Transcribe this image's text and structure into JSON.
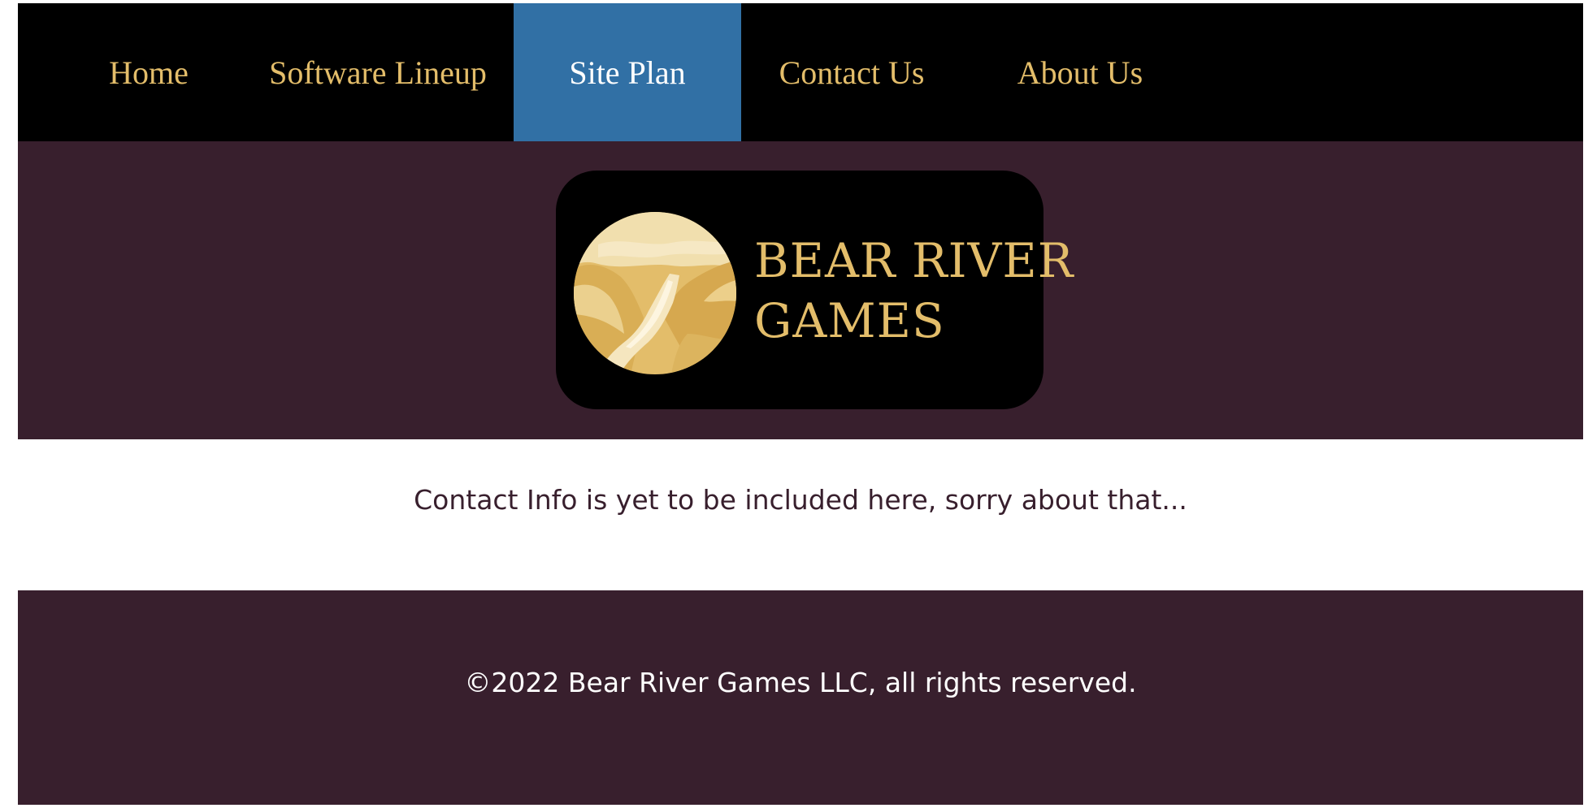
{
  "nav": {
    "items": [
      {
        "label": "Home",
        "active": false
      },
      {
        "label": "Software Lineup",
        "active": false
      },
      {
        "label": "Site Plan",
        "active": true
      },
      {
        "label": "Contact Us",
        "active": false
      },
      {
        "label": "About Us",
        "active": false
      }
    ]
  },
  "header": {
    "logo": {
      "line1": "BEAR RIVER",
      "line2": "GAMES",
      "emblem": "river-valley-mountains-emblem"
    }
  },
  "main": {
    "message": "Contact Info is yet to be included here, sorry about that..."
  },
  "footer": {
    "copyright": "©2022 Bear River Games LLC, all rights reserved."
  },
  "colors": {
    "nav_bg": "#000000",
    "nav_text": "#e3bd6a",
    "nav_active_bg": "#3170a5",
    "nav_active_text": "#ffffff",
    "brand_maroon": "#381f2d",
    "logo_gold": "#e3bd6a"
  }
}
